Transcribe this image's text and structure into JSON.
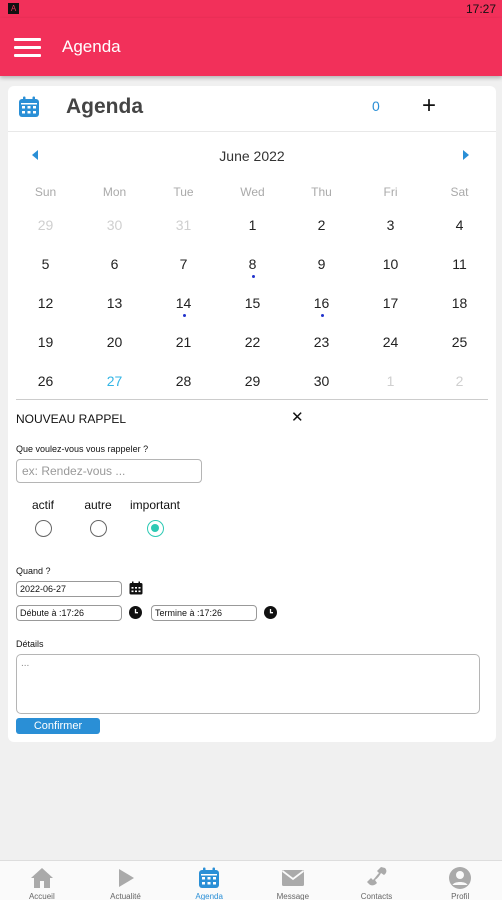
{
  "status_bar": {
    "icon": "android-notification-icon",
    "time": "17:27"
  },
  "app_bar": {
    "title": "Agenda"
  },
  "header": {
    "title": "Agenda",
    "count": "0",
    "add_label": "+"
  },
  "calendar": {
    "month_label": "June 2022",
    "weekdays": [
      "Sun",
      "Mon",
      "Tue",
      "Wed",
      "Thu",
      "Fri",
      "Sat"
    ],
    "days": [
      {
        "label": "29",
        "muted": true
      },
      {
        "label": "30",
        "muted": true
      },
      {
        "label": "31",
        "muted": true
      },
      {
        "label": "1"
      },
      {
        "label": "2"
      },
      {
        "label": "3"
      },
      {
        "label": "4"
      },
      {
        "label": "5"
      },
      {
        "label": "6"
      },
      {
        "label": "7"
      },
      {
        "label": "8",
        "event": true
      },
      {
        "label": "9"
      },
      {
        "label": "10"
      },
      {
        "label": "11"
      },
      {
        "label": "12"
      },
      {
        "label": "13"
      },
      {
        "label": "14",
        "event": true
      },
      {
        "label": "15"
      },
      {
        "label": "16",
        "event": true
      },
      {
        "label": "17"
      },
      {
        "label": "18"
      },
      {
        "label": "19"
      },
      {
        "label": "20"
      },
      {
        "label": "21"
      },
      {
        "label": "22"
      },
      {
        "label": "23"
      },
      {
        "label": "24"
      },
      {
        "label": "25"
      },
      {
        "label": "26"
      },
      {
        "label": "27",
        "today": true
      },
      {
        "label": "28"
      },
      {
        "label": "29"
      },
      {
        "label": "30"
      },
      {
        "label": "1",
        "muted": true
      },
      {
        "label": "2",
        "muted": true
      }
    ]
  },
  "form": {
    "title": "NOUVEAU RAPPEL",
    "close_label": "✕",
    "question_label": "Que voulez-vous vous rappeler ?",
    "question_placeholder": "ex: Rendez-vous ...",
    "options": [
      {
        "label": "actif",
        "checked": false
      },
      {
        "label": "autre",
        "checked": false
      },
      {
        "label": "important",
        "checked": true
      }
    ],
    "when_label": "Quand ?",
    "date_value": "2022-06-27",
    "start_value": "Débute à :17:26",
    "end_value": "Termine à :17:26",
    "details_label": "Détails",
    "details_placeholder": "...",
    "confirm_label": "Confirmer"
  },
  "bottom_nav": [
    {
      "label": "Accueil",
      "icon": "home-icon"
    },
    {
      "label": "Actualité",
      "icon": "play-icon"
    },
    {
      "label": "Agenda",
      "icon": "calendar-icon",
      "active": true
    },
    {
      "label": "Message",
      "icon": "envelope-icon"
    },
    {
      "label": "Contacts",
      "icon": "phone-icon"
    },
    {
      "label": "Profil",
      "icon": "person-icon"
    }
  ],
  "colors": {
    "accent": "#f2305a",
    "link": "#2a8fd6",
    "radio_checked": "#2dc9b4",
    "event_dot": "#2233cc"
  }
}
